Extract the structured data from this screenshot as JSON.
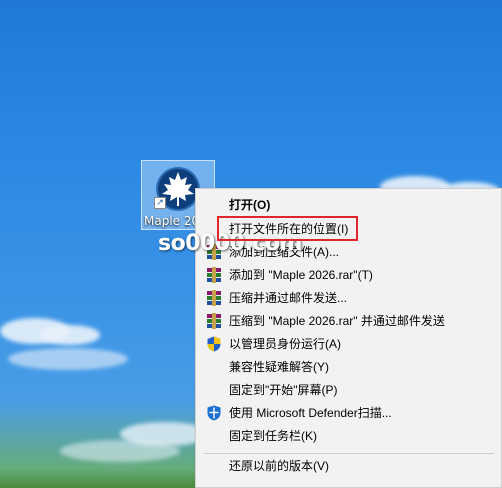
{
  "desktop": {
    "icon_label": "Maple 2026",
    "watermark": "so0000.com"
  },
  "context_menu": {
    "items": [
      {
        "label": "打开(O)",
        "icon": ""
      },
      {
        "label": "打开文件所在的位置(I)",
        "icon": ""
      },
      {
        "label": "添加到压缩文件(A)...",
        "icon": "winrar-icon"
      },
      {
        "label": "添加到 \"Maple 2026.rar\"(T)",
        "icon": "winrar-icon"
      },
      {
        "label": "压缩并通过邮件发送...",
        "icon": "winrar-icon"
      },
      {
        "label": "压缩到 \"Maple 2026.rar\" 并通过邮件发送",
        "icon": "winrar-icon"
      },
      {
        "label": "以管理员身份运行(A)",
        "icon": "uac-shield-icon"
      },
      {
        "label": "兼容性疑难解答(Y)",
        "icon": ""
      },
      {
        "label": "固定到\"开始\"屏幕(P)",
        "icon": ""
      },
      {
        "label": "使用 Microsoft Defender扫描...",
        "icon": "defender-shield-icon"
      },
      {
        "label": "固定到任务栏(K)",
        "icon": ""
      },
      {
        "label": "还原以前的版本(V)",
        "icon": ""
      }
    ]
  },
  "colors": {
    "highlight_box": "#e0262a",
    "menu_background": "#f2f2f2"
  }
}
